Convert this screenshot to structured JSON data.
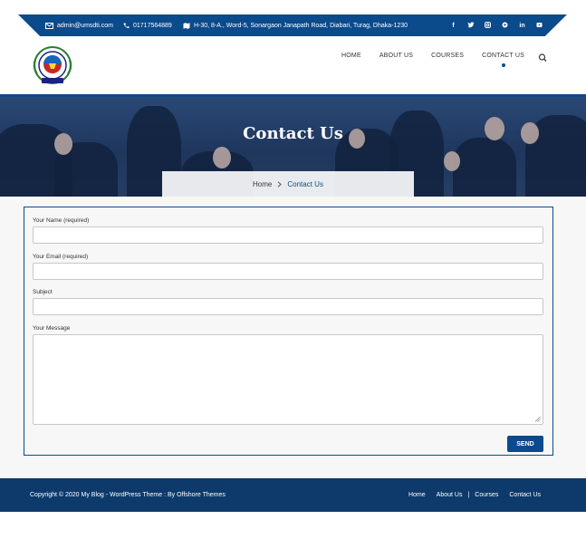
{
  "topbar": {
    "email": "admin@umsdti.com",
    "phone": "01717564889",
    "address": "H-30, 8-A., Word-5, Sonargaon Janapath Road, Diabari, Turag, Dhaka-1230",
    "social": [
      "f",
      "t",
      "ig",
      "p",
      "in",
      "yt"
    ]
  },
  "nav": {
    "items": [
      "HOME",
      "ABOUT US",
      "COURSES",
      "CONTACT US"
    ],
    "active": "CONTACT US"
  },
  "hero": {
    "title": "Contact Us",
    "breadcrumb_home": "Home",
    "breadcrumb_current": "Contact Us"
  },
  "form": {
    "name_label": "Your Name (required)",
    "email_label": "Your Email (required)",
    "subject_label": "Subject",
    "message_label": "Your Message",
    "send_label": "SEND"
  },
  "footer": {
    "copyright": "Copyright © 2020 My Blog - WordPress Theme : By  Offshore Themes",
    "links": [
      "Home",
      "About Us",
      "Courses",
      "Contact Us"
    ]
  },
  "colors": {
    "primary": "#0b4a8b",
    "footer": "#0d3a6b"
  }
}
